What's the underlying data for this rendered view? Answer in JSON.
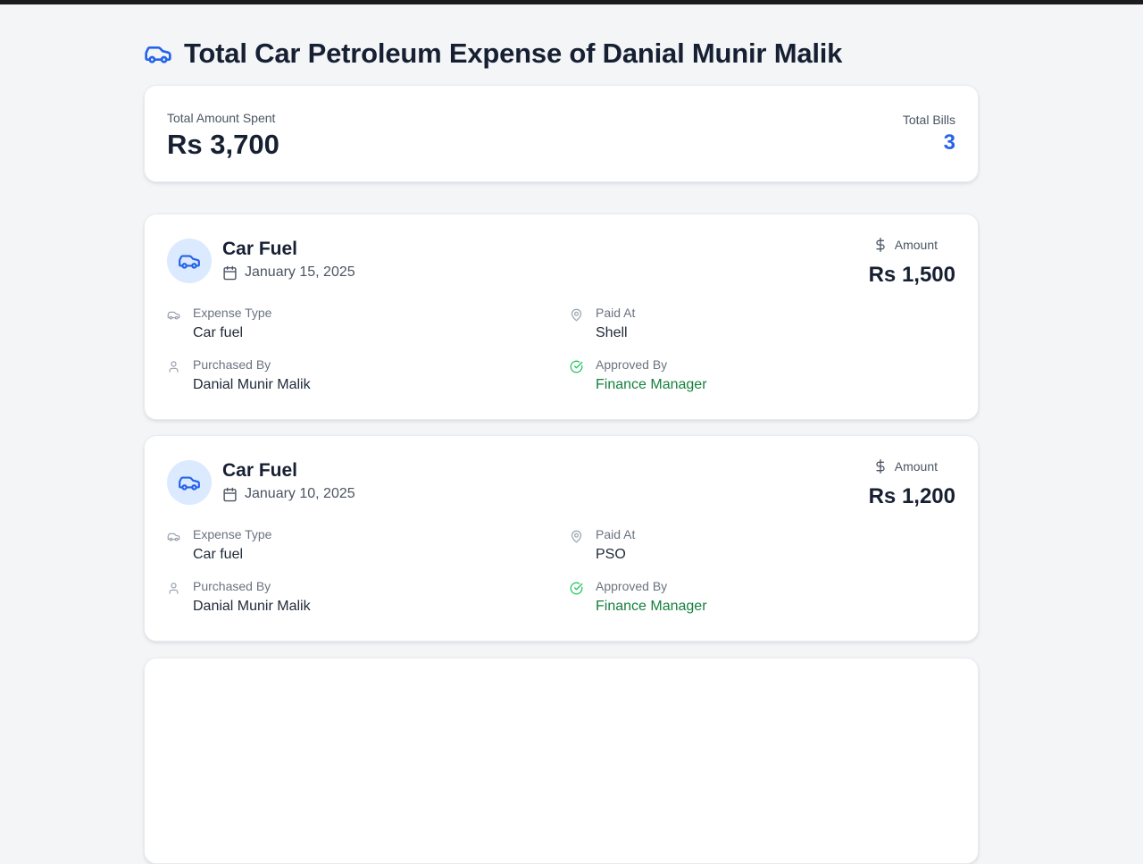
{
  "page": {
    "title": "Total Car Petroleum Expense of Danial Munir Malik",
    "header_icon": "car-icon"
  },
  "summary": {
    "total_label": "Total Amount Spent",
    "total_value": "Rs 3,700",
    "bills_label": "Total Bills",
    "bills_value": "3"
  },
  "colors": {
    "accent": "#2563eb",
    "approved": "#15803d",
    "avatar_bg": "#dbeafe"
  },
  "expenses": [
    {
      "title": "Car Fuel",
      "date": "January 15, 2025",
      "amount_label": "Amount",
      "amount": "Rs 1,500",
      "expense_type_label": "Expense Type",
      "expense_type": "Car fuel",
      "paid_at_label": "Paid At",
      "paid_at": "Shell",
      "purchased_by_label": "Purchased By",
      "purchased_by": "Danial Munir Malik",
      "approved_by_label": "Approved By",
      "approved_by": "Finance Manager"
    },
    {
      "title": "Car Fuel",
      "date": "January 10, 2025",
      "amount_label": "Amount",
      "amount": "Rs 1,200",
      "expense_type_label": "Expense Type",
      "expense_type": "Car fuel",
      "paid_at_label": "Paid At",
      "paid_at": "PSO",
      "purchased_by_label": "Purchased By",
      "purchased_by": "Danial Munir Malik",
      "approved_by_label": "Approved By",
      "approved_by": "Finance Manager"
    },
    {
      "title": "",
      "date": "",
      "amount_label": "",
      "amount": "",
      "expense_type_label": "",
      "expense_type": "",
      "paid_at_label": "",
      "paid_at": "",
      "purchased_by_label": "",
      "purchased_by": "",
      "approved_by_label": "",
      "approved_by": ""
    }
  ]
}
